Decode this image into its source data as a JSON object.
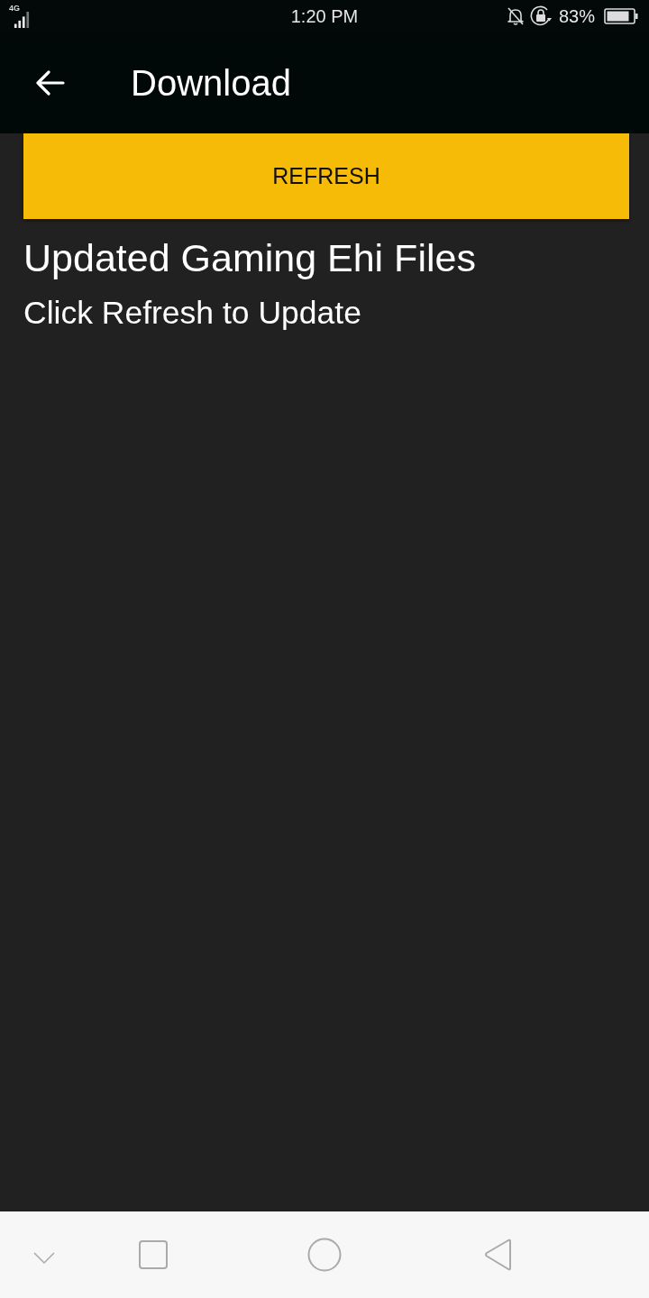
{
  "status_bar": {
    "network": "4G",
    "time": "1:20 PM",
    "battery": "83%"
  },
  "app_bar": {
    "title": "Download"
  },
  "refresh_button": {
    "label": "REFRESH"
  },
  "content": {
    "heading": "Updated Gaming Ehi Files",
    "subheading": "Click Refresh to Update"
  }
}
